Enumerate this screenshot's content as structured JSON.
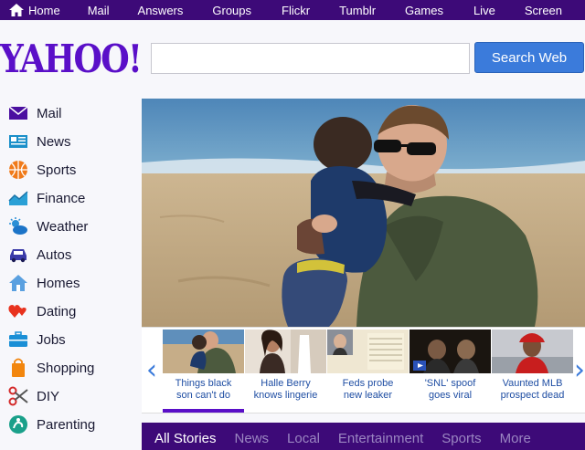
{
  "topbar": {
    "items": [
      "Home",
      "Mail",
      "Answers",
      "Groups",
      "Flickr",
      "Tumblr",
      "Games",
      "Live",
      "Screen"
    ]
  },
  "logo": "YAHOO!",
  "search": {
    "placeholder": "",
    "button": "Search Web"
  },
  "sidebar": {
    "items": [
      {
        "label": "Mail",
        "icon": "envelope-icon"
      },
      {
        "label": "News",
        "icon": "newspaper-icon"
      },
      {
        "label": "Sports",
        "icon": "basketball-icon"
      },
      {
        "label": "Finance",
        "icon": "chart-icon"
      },
      {
        "label": "Weather",
        "icon": "sun-cloud-icon"
      },
      {
        "label": "Autos",
        "icon": "car-icon"
      },
      {
        "label": "Homes",
        "icon": "house-icon"
      },
      {
        "label": "Dating",
        "icon": "hearts-icon"
      },
      {
        "label": "Jobs",
        "icon": "briefcase-icon"
      },
      {
        "label": "Shopping",
        "icon": "shopping-bag-icon"
      },
      {
        "label": "DIY",
        "icon": "scissors-icon"
      },
      {
        "label": "Parenting",
        "icon": "hand-heart-icon"
      }
    ]
  },
  "stories": {
    "items": [
      {
        "caption_line1": "Things black",
        "caption_line2": "son can't do"
      },
      {
        "caption_line1": "Halle Berry",
        "caption_line2": "knows lingerie"
      },
      {
        "caption_line1": "Feds probe",
        "caption_line2": "new leaker"
      },
      {
        "caption_line1": "'SNL' spoof",
        "caption_line2": "goes viral"
      },
      {
        "caption_line1": "Vaunted MLB",
        "caption_line2": "prospect dead"
      }
    ]
  },
  "tabs": [
    "All Stories",
    "News",
    "Local",
    "Entertainment",
    "Sports",
    "More"
  ],
  "colors": {
    "brand_purple": "#3d0a78",
    "logo_purple": "#5a0fc8",
    "search_blue": "#3b7bdb"
  }
}
